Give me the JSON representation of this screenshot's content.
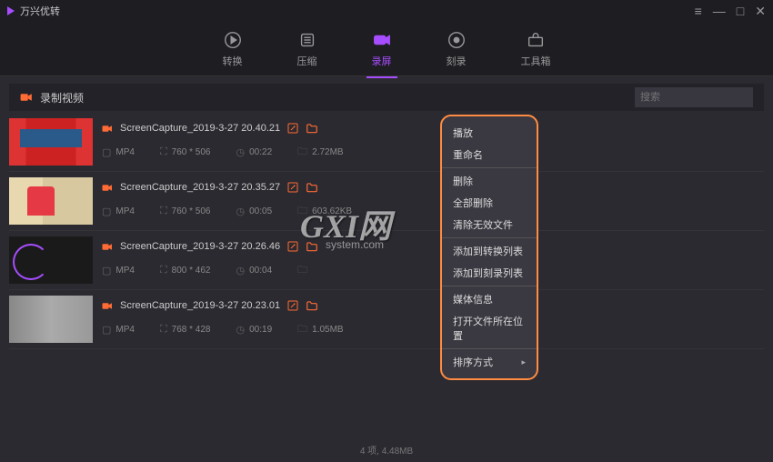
{
  "app": {
    "title": "万兴优转"
  },
  "nav": {
    "convert": "转换",
    "compress": "压缩",
    "record": "录屏",
    "burn": "刻录",
    "toolbox": "工具箱"
  },
  "subbar": {
    "title": "录制视频"
  },
  "search": {
    "placeholder": "搜索"
  },
  "rows": [
    {
      "name": "ScreenCapture_2019-3-27 20.40.21",
      "format": "MP4",
      "res": "760 * 506",
      "dur": "00:22",
      "size": "2.72MB"
    },
    {
      "name": "ScreenCapture_2019-3-27 20.35.27",
      "format": "MP4",
      "res": "760 * 506",
      "dur": "00:05",
      "size": "603.62KB"
    },
    {
      "name": "ScreenCapture_2019-3-27 20.26.46",
      "format": "MP4",
      "res": "800 * 462",
      "dur": "00:04",
      "size": ""
    },
    {
      "name": "ScreenCapture_2019-3-27 20.23.01",
      "format": "MP4",
      "res": "768 * 428",
      "dur": "00:19",
      "size": "1.05MB"
    }
  ],
  "context": {
    "play": "播放",
    "rename": "重命名",
    "delete": "删除",
    "deleteAll": "全部删除",
    "clearInvalid": "清除无效文件",
    "addConvert": "添加到转换列表",
    "addBurn": "添加到刻录列表",
    "mediaInfo": "媒体信息",
    "openLocation": "打开文件所在位置",
    "sort": "排序方式"
  },
  "footer": {
    "summary": "4 项, 4.48MB"
  },
  "watermark": {
    "main": "GXI网",
    "sub": "system.com"
  }
}
